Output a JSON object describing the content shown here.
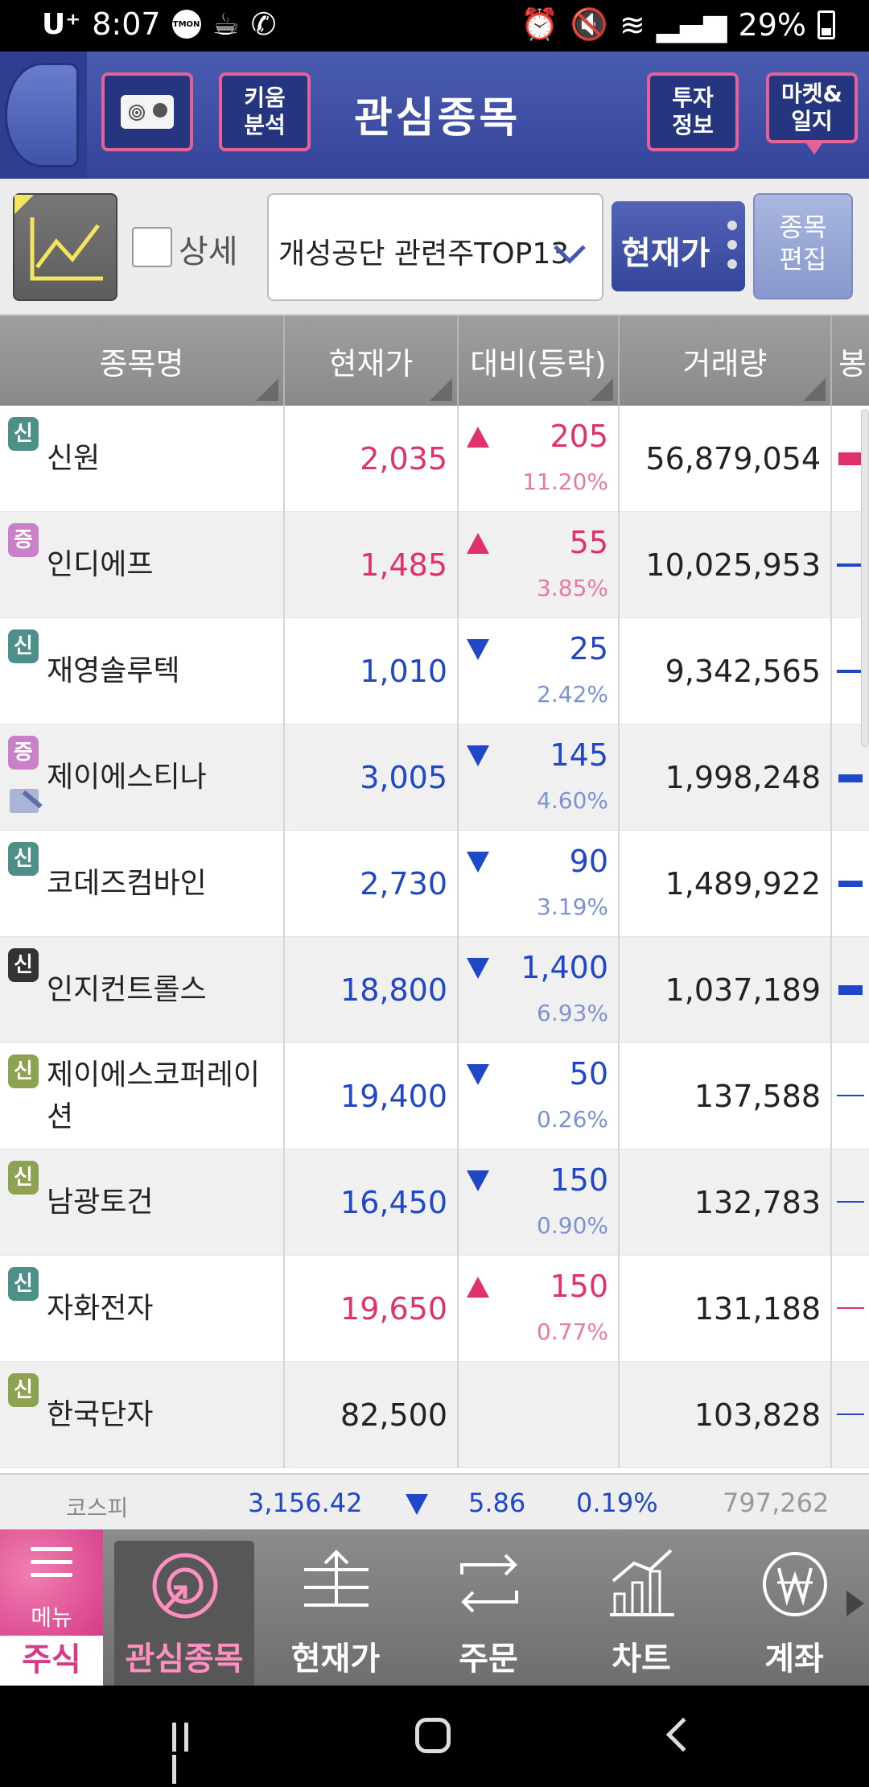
{
  "status_bar": {
    "carrier": "U⁺",
    "time": "8:07",
    "icon_badge": "TMON",
    "battery": "29%"
  },
  "header": {
    "title": "관심종목",
    "kiwoom": "키움\n분석",
    "tuja": "투자\n정보",
    "market": "마켓&\n일지"
  },
  "toolbar": {
    "detail_label": "상세",
    "group_name": "개성공단 관련주TOP13",
    "price_button": "현재가",
    "edit_button": "종목\n편집"
  },
  "table": {
    "headers": [
      "종목명",
      "현재가",
      "대비(등락)",
      "거래량",
      "봉"
    ],
    "rows": [
      {
        "badge": "신",
        "name": "신원",
        "price": "2,035",
        "change": "205",
        "pct": "11.20%",
        "volume": "56,879,054"
      },
      {
        "badge": "증",
        "name": "인디에프",
        "price": "1,485",
        "change": "55",
        "pct": "3.85%",
        "volume": "10,025,953"
      },
      {
        "badge": "신",
        "name": "재영솔루텍",
        "price": "1,010",
        "change": "25",
        "pct": "2.42%",
        "volume": "9,342,565"
      },
      {
        "badge": "증",
        "name": "제이에스티나",
        "price": "3,005",
        "change": "145",
        "pct": "4.60%",
        "volume": "1,998,248"
      },
      {
        "badge": "신",
        "name": "코데즈컴바인",
        "price": "2,730",
        "change": "90",
        "pct": "3.19%",
        "volume": "1,489,922"
      },
      {
        "badge": "신",
        "name": "인지컨트롤스",
        "price": "18,800",
        "change": "1,400",
        "pct": "6.93%",
        "volume": "1,037,189"
      },
      {
        "badge": "신",
        "name": "제이에스코퍼레이션",
        "price": "19,400",
        "change": "50",
        "pct": "0.26%",
        "volume": "137,588"
      },
      {
        "badge": "신",
        "name": "남광토건",
        "price": "16,450",
        "change": "150",
        "pct": "0.90%",
        "volume": "132,783"
      },
      {
        "badge": "신",
        "name": "자화전자",
        "price": "19,650",
        "change": "150",
        "pct": "0.77%",
        "volume": "131,188"
      },
      {
        "badge": "신",
        "name": "한국단자",
        "price": "82,500",
        "change": "",
        "pct": "",
        "volume": "103,828"
      }
    ]
  },
  "kospi": {
    "name": "코스피",
    "index": "3,156.42",
    "change": "5.86",
    "pct": "0.19%",
    "volume": "797,262"
  },
  "bottom_nav": {
    "menu": "메뉴",
    "stock": "주식",
    "items": [
      "관심종목",
      "현재가",
      "주문",
      "차트",
      "계좌"
    ]
  },
  "colors": {
    "up": "#e0306e",
    "down": "#2047c8",
    "header": "#3c4ea6",
    "accent_pink": "#e36399"
  }
}
